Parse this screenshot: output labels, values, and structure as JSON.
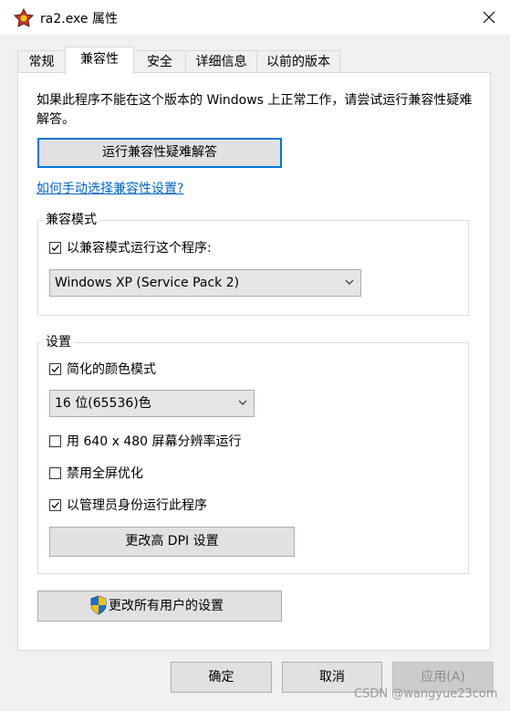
{
  "window": {
    "title": "ra2.exe 属性",
    "app_icon": "ra2-app-icon",
    "close_icon": "close-icon"
  },
  "tabs": [
    {
      "label": "常规"
    },
    {
      "label": "兼容性",
      "active": true
    },
    {
      "label": "安全"
    },
    {
      "label": "详细信息"
    },
    {
      "label": "以前的版本"
    }
  ],
  "compat": {
    "description": "如果此程序不能在这个版本的 Windows 上正常工作，请尝试运行兼容性疑难解答。",
    "troubleshooter_button": "运行兼容性疑难解答",
    "manual_link": "如何手动选择兼容性设置?",
    "mode_group": {
      "label": "兼容模式",
      "checkbox_label": "以兼容模式运行这个程序:",
      "checked": true,
      "os_select_value": "Windows XP (Service Pack 2)"
    },
    "settings_group": {
      "label": "设置",
      "reduced_color": {
        "label": "简化的颜色模式",
        "checked": true
      },
      "color_select_value": "16 位(65536)色",
      "res_640": {
        "label": "用 640 x 480 屏幕分辨率运行",
        "checked": false
      },
      "disable_fullscreen": {
        "label": "禁用全屏优化",
        "checked": false
      },
      "run_as_admin": {
        "label": "以管理员身份运行此程序",
        "checked": true
      },
      "dpi_button": "更改高 DPI 设置"
    },
    "all_users_button": "更改所有用户的设置",
    "shield_icon": "uac-shield-icon"
  },
  "footer": {
    "ok": "确定",
    "cancel": "取消",
    "apply": "应用(A)"
  },
  "watermark": "CSDN @wangyue23com",
  "colors": {
    "accent": "#0078d7",
    "link": "#0066cc",
    "disabled_text": "#8c8c8c"
  }
}
